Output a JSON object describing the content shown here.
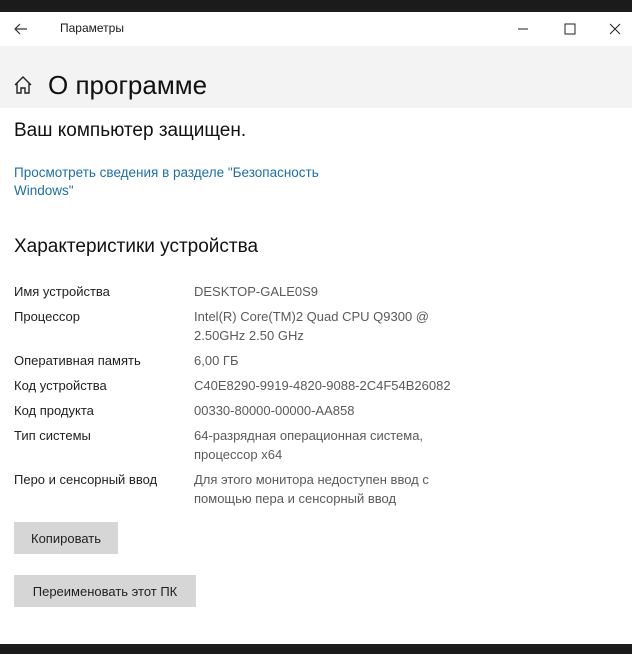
{
  "window": {
    "title": "Параметры"
  },
  "header": {
    "title": "О программе"
  },
  "security": {
    "status": "Ваш компьютер защищен.",
    "link": "Просмотреть сведения в разделе \"Безопасность Windows\""
  },
  "device": {
    "heading": "Характеристики устройства",
    "specs": [
      {
        "label": "Имя устройства",
        "value": "DESKTOP-GALE0S9"
      },
      {
        "label": "Процессор",
        "value": "Intel(R) Core(TM)2 Quad  CPU   Q9300  @ 2.50GHz   2.50 GHz"
      },
      {
        "label": "Оперативная память",
        "value": "6,00 ГБ"
      },
      {
        "label": "Код устройства",
        "value": "C40E8290-9919-4820-9088-2C4F54B26082"
      },
      {
        "label": "Код продукта",
        "value": "00330-80000-00000-AA858"
      },
      {
        "label": "Тип системы",
        "value": "64-разрядная операционная система, процессор x64"
      },
      {
        "label": "Перо и сенсорный ввод",
        "value": "Для этого монитора недоступен ввод с помощью пера и сенсорный ввод"
      }
    ]
  },
  "buttons": {
    "copy": "Копировать",
    "rename": "Переименовать этот ПК"
  },
  "icons": {
    "back": "back-arrow-icon",
    "minimize": "minimize-icon",
    "maximize": "maximize-icon",
    "close": "close-icon",
    "home": "home-icon"
  }
}
